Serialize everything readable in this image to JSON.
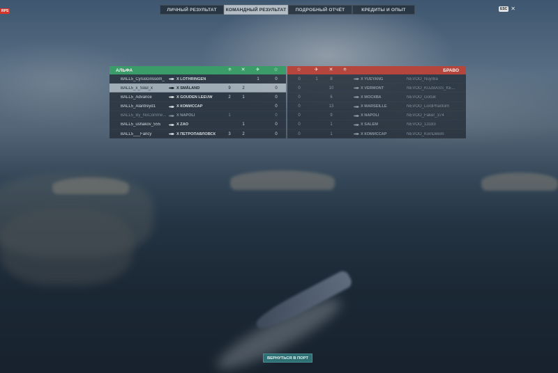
{
  "corner_badge": "RPS",
  "tabs": [
    {
      "label": "ЛИЧНЫЙ РЕЗУЛЬТАТ",
      "active": false
    },
    {
      "label": "КОМАНДНЫЙ РЕЗУЛЬТАТ",
      "active": true
    },
    {
      "label": "ПОДРОБНЫЙ ОТЧЁТ",
      "active": false
    },
    {
      "label": "КРЕДИТЫ И ОПЫТ",
      "active": false
    }
  ],
  "close": {
    "key": "ESC",
    "symbol": "✕"
  },
  "teams": {
    "alpha": {
      "name": "АЛЬФА",
      "color": "#3b9c6a",
      "columns": [
        "base-capture-icon",
        "kills-icon",
        "planes-icon",
        "star-icon"
      ],
      "rows": [
        {
          "player": "BALL5_CyrusGrissom_",
          "ship": "X LOTHRINGEN",
          "cap": "",
          "kills": "",
          "planes": "1",
          "score": "0",
          "highlight": false,
          "dim": false
        },
        {
          "player": "BALL5_x_Soul_x",
          "ship": "X SMÅLAND",
          "cap": "9",
          "kills": "2",
          "planes": "",
          "score": "0",
          "highlight": true,
          "dim": false
        },
        {
          "player": "BALL5_Advance",
          "ship": "X GOUDEN LEEUW",
          "cap": "2",
          "kills": "1",
          "planes": "",
          "score": "0",
          "highlight": false,
          "dim": false
        },
        {
          "player": "BALL5_Alantreyd1",
          "ship": "X КОМИССАР",
          "cap": "",
          "kills": "",
          "planes": "",
          "score": "0",
          "highlight": false,
          "dim": false
        },
        {
          "player": "BALL5_By_NoComme...",
          "ship": "X NAPOLI",
          "cap": "1",
          "kills": "",
          "planes": "",
          "score": "0",
          "highlight": false,
          "dim": true
        },
        {
          "player": "BALL5_ushakov_555",
          "ship": "X ZAO",
          "cap": "",
          "kills": "1",
          "planes": "",
          "score": "0",
          "highlight": false,
          "dim": false
        },
        {
          "player": "BALL5___Fancy",
          "ship": "X ПЕТРОПАВЛОВСК",
          "cap": "3",
          "kills": "2",
          "planes": "",
          "score": "0",
          "highlight": false,
          "dim": false
        }
      ]
    },
    "bravo": {
      "name": "БРАВО",
      "color": "#b5463d",
      "columns": [
        "star-icon",
        "planes-icon",
        "kills-icon",
        "base-capture-icon"
      ],
      "rows": [
        {
          "score": "0",
          "planes": "1",
          "kills": "8",
          "ship": "X YUEYANG",
          "player": "NEVOO_NuyrBa"
        },
        {
          "score": "0",
          "planes": "",
          "kills": "10",
          "ship": "X VERMONT",
          "player": "NEVOO_KUZBASS_KE..."
        },
        {
          "score": "0",
          "planes": "",
          "kills": "6",
          "ship": "X МОСКВА",
          "player": "NEVOO_Gotsik"
        },
        {
          "score": "0",
          "planes": "",
          "kills": "13",
          "ship": "X MARSEILLE",
          "player": "NEVOO_LordPhantom"
        },
        {
          "score": "0",
          "planes": "",
          "kills": "9",
          "ship": "X NAPOLI",
          "player": "NEVOO_Faker_374"
        },
        {
          "score": "0",
          "planes": "",
          "kills": "1",
          "ship": "X SALEM",
          "player": "NEVOO_13183"
        },
        {
          "score": "0",
          "planes": "",
          "kills": "1",
          "ship": "X КОМИССАР",
          "player": "NEVOO_KvinDekim"
        }
      ]
    }
  },
  "return_button": "ВЕРНУТЬСЯ В ПОРТ"
}
